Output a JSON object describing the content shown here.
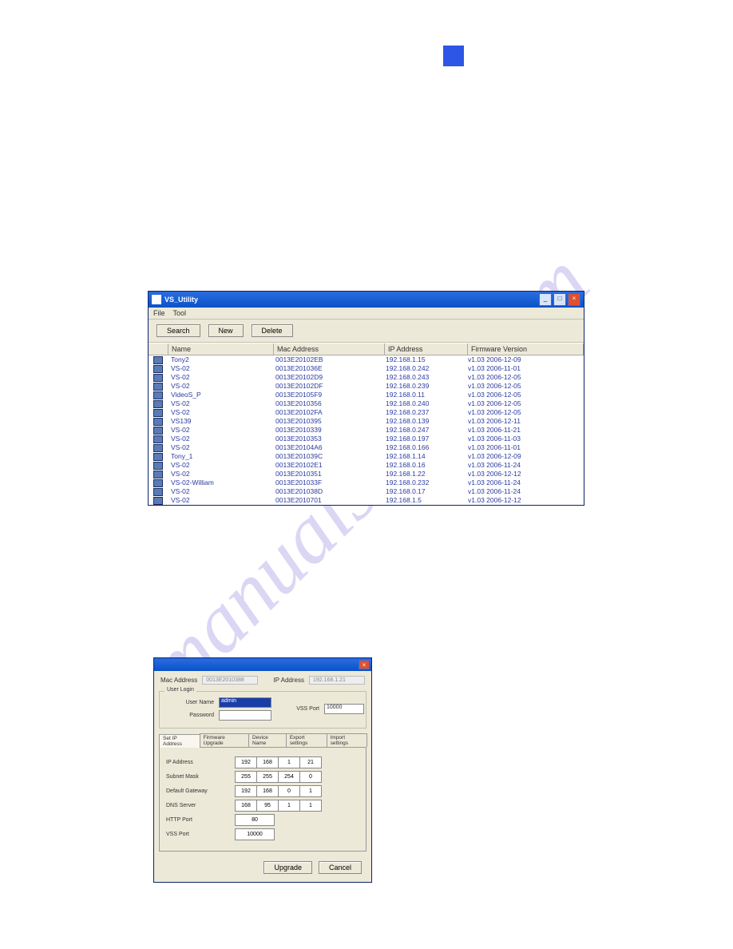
{
  "square_color": "#2d56e6",
  "watermark_text": "manualshive.com",
  "win1": {
    "title": "VS_Utility",
    "menu": [
      "File",
      "Tool"
    ],
    "buttons": {
      "search": "Search",
      "new": "New",
      "delete": "Delete"
    },
    "columns": {
      "name": "Name",
      "mac": "Mac Address",
      "ip": "IP Address",
      "fw": "Firmware Version"
    },
    "rows": [
      {
        "name": "Tony2",
        "mac": "0013E20102EB",
        "ip": "192.168.1.15",
        "fw": "v1.03 2006-12-09"
      },
      {
        "name": "VS-02",
        "mac": "0013E201036E",
        "ip": "192.168.0.242",
        "fw": "v1.03 2006-11-01"
      },
      {
        "name": "VS-02",
        "mac": "0013E20102D9",
        "ip": "192.168.0.243",
        "fw": "v1.03 2006-12-05"
      },
      {
        "name": "VS-02",
        "mac": "0013E20102DF",
        "ip": "192.168.0.239",
        "fw": "v1.03 2006-12-05"
      },
      {
        "name": "VideoS_P",
        "mac": "0013E20105F9",
        "ip": "192.168.0.11",
        "fw": "v1.03 2006-12-05"
      },
      {
        "name": "VS-02",
        "mac": "0013E2010356",
        "ip": "192.168.0.240",
        "fw": "v1.03 2006-12-05"
      },
      {
        "name": "VS-02",
        "mac": "0013E20102FA",
        "ip": "192.168.0.237",
        "fw": "v1.03 2006-12-05"
      },
      {
        "name": "VS139",
        "mac": "0013E2010395",
        "ip": "192.168.0.139",
        "fw": "v1.03 2006-12-11"
      },
      {
        "name": "VS-02",
        "mac": "0013E2010339",
        "ip": "192.168.0.247",
        "fw": "v1.03 2006-11-21"
      },
      {
        "name": "VS-02",
        "mac": "0013E2010353",
        "ip": "192.168.0.197",
        "fw": "v1.03 2006-11-03"
      },
      {
        "name": "VS-02",
        "mac": "0013E20104A6",
        "ip": "192.168.0.166",
        "fw": "v1.03 2006-11-01"
      },
      {
        "name": "Tony_1",
        "mac": "0013E201039C",
        "ip": "192.168.1.14",
        "fw": "v1.03 2006-12-09"
      },
      {
        "name": "VS-02",
        "mac": "0013E20102E1",
        "ip": "192.168.0.16",
        "fw": "v1.03 2006-11-24"
      },
      {
        "name": "VS-02",
        "mac": "0013E2010351",
        "ip": "192.168.1.22",
        "fw": "v1.03 2006-12-12"
      },
      {
        "name": "VS-02-William",
        "mac": "0013E201033F",
        "ip": "192.168.0.232",
        "fw": "v1.03 2006-11-24"
      },
      {
        "name": "VS-02",
        "mac": "0013E201038D",
        "ip": "192.168.0.17",
        "fw": "v1.03 2006-11-24"
      },
      {
        "name": "VS-02",
        "mac": "0013E2010701",
        "ip": "192.168.1.5",
        "fw": "v1.03 2006-12-12"
      }
    ]
  },
  "win2": {
    "labels": {
      "mac": "Mac Address",
      "ip": "IP Address",
      "userlogin": "User Login",
      "username": "User Name",
      "password": "Password",
      "vssport": "VSS Port",
      "ipaddress": "IP Address",
      "subnet": "Subnet Mask",
      "gateway": "Default Gateway",
      "dns": "DNS Server",
      "httpport": "HTTP Port",
      "vssport2": "VSS Port"
    },
    "readonly": {
      "mac": "0013E2010388",
      "ip": "192.168.1.21"
    },
    "login": {
      "username": "admin",
      "password": "",
      "vssport": "10000"
    },
    "tabs": [
      "Set IP Address",
      "Firmware Upgrade",
      "Device Name",
      "Export settings",
      "Import settings"
    ],
    "fields": {
      "ip": [
        "192",
        "168",
        "1",
        "21"
      ],
      "subnet": [
        "255",
        "255",
        "254",
        "0"
      ],
      "gateway": [
        "192",
        "168",
        "0",
        "1"
      ],
      "dns": [
        "168",
        "95",
        "1",
        "1"
      ],
      "http": "80",
      "vss": "10000"
    },
    "buttons": {
      "upgrade": "Upgrade",
      "cancel": "Cancel"
    }
  }
}
